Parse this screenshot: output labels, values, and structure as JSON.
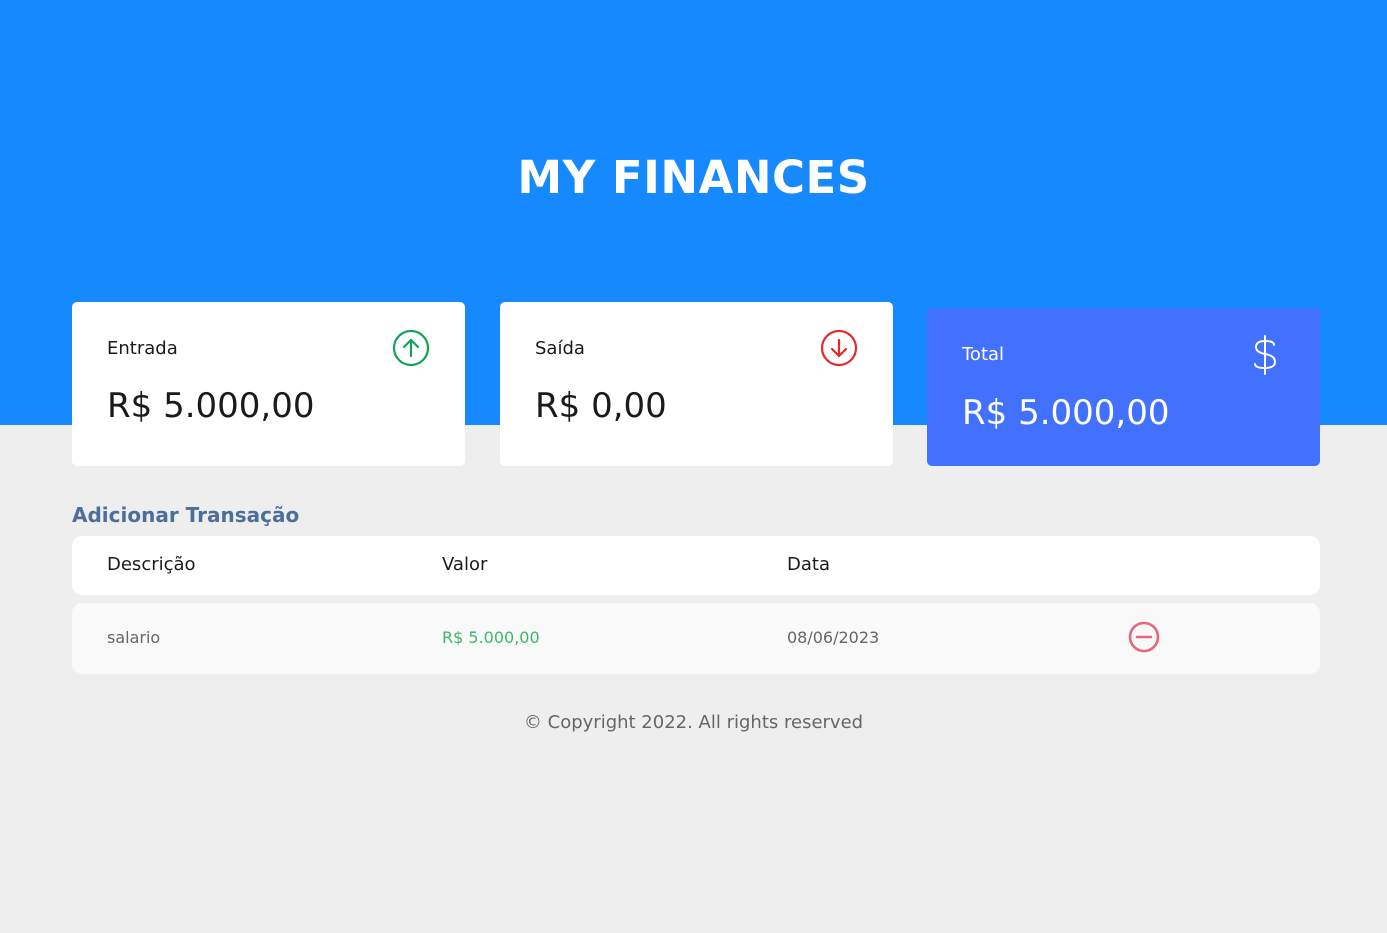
{
  "header": {
    "title": "MY FINANCES",
    "background_color": "#1789ff"
  },
  "cards": {
    "entrada": {
      "label": "Entrada",
      "value": "R$ 5.000,00",
      "icon": "arrow-up-circle-icon",
      "icon_color": "#12a454"
    },
    "saida": {
      "label": "Saída",
      "value": "R$ 0,00",
      "icon": "arrow-down-circle-icon",
      "icon_color": "#e92929"
    },
    "total": {
      "label": "Total",
      "value": "R$ 5.000,00",
      "icon": "dollar-sign-icon",
      "background_color": "#4270ff"
    }
  },
  "transactions": {
    "add_link": "Adicionar Transação",
    "columns": [
      "Descrição",
      "Valor",
      "Data"
    ],
    "rows": [
      {
        "description": "salario",
        "amount": "R$ 5.000,00",
        "date": "08/06/2023",
        "remove_icon": "minus-circle-icon"
      }
    ]
  },
  "footer": {
    "copyright": "© Copyright 2022. All rights reserved"
  }
}
